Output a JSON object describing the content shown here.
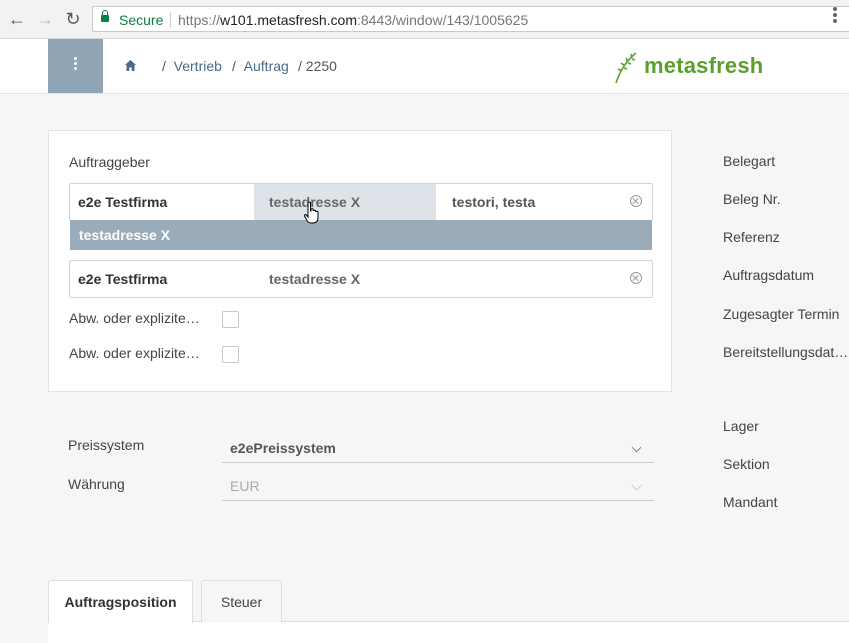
{
  "browser": {
    "secure_label": "Secure",
    "url_scheme": "https://",
    "url_host": "w101.metasfresh.com",
    "url_rest": ":8443/window/143/1005625"
  },
  "header": {
    "breadcrumb": [
      {
        "sep": "/",
        "label": "Vertrieb"
      },
      {
        "sep": "/",
        "label": "Auftrag"
      },
      {
        "sep": "/",
        "label": "2250"
      }
    ],
    "logo_text": "metasfresh"
  },
  "form": {
    "auftraggeber_label": "Auftraggeber",
    "bpartner_field": {
      "partner": "e2e Testfirma",
      "location": "testadresse X",
      "contact": "testori, testa"
    },
    "dropdown_option": "testadresse X",
    "bill_field": {
      "partner": "e2e Testfirma",
      "location": "testadresse X"
    },
    "checkbox1_label": "Abw. oder explizite…",
    "checkbox2_label": "Abw. oder explizite…",
    "preissystem_label": "Preissystem",
    "preissystem_value": "e2ePreissystem",
    "waehrung_label": "Währung",
    "waehrung_value": "EUR"
  },
  "right_column": {
    "belegart": "Belegart",
    "beleg_nr": "Beleg Nr.",
    "referenz": "Referenz",
    "auftragsdatum": "Auftragsdatum",
    "zugesagter_termin": "Zugesagter Termin",
    "bereitstellungsdatum": "Bereitstellungsdat…",
    "lager": "Lager",
    "sektion": "Sektion",
    "mandant": "Mandant"
  },
  "tabs": [
    {
      "label": "Auftragsposition",
      "active": true
    },
    {
      "label": "Steuer",
      "active": false
    }
  ],
  "colors": {
    "brand_green": "#5aa02c",
    "menu_toggle": "#8fa5b5",
    "dropdown_highlight": "#9aabb9"
  }
}
